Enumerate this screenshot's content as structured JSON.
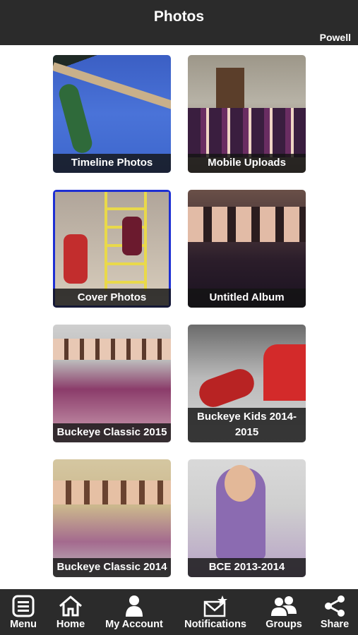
{
  "header": {
    "title": "Photos",
    "subtitle": "Powell"
  },
  "albums": [
    {
      "title": "Timeline Photos"
    },
    {
      "title": "Mobile Uploads"
    },
    {
      "title": "Cover Photos"
    },
    {
      "title": "Untitled Album"
    },
    {
      "title": "Buckeye Classic 2015"
    },
    {
      "title": "Buckeye Kids 2014-2015"
    },
    {
      "title": "Buckeye Classic 2014"
    },
    {
      "title": "BCE 2013-2014"
    }
  ],
  "nav": {
    "items": [
      {
        "label": "Menu",
        "icon": "menu-icon"
      },
      {
        "label": "Home",
        "icon": "home-icon"
      },
      {
        "label": "My Account",
        "icon": "account-icon"
      },
      {
        "label": "Notifications",
        "icon": "notifications-icon"
      },
      {
        "label": "Groups",
        "icon": "groups-icon"
      },
      {
        "label": "Share",
        "icon": "share-icon"
      }
    ]
  },
  "colors": {
    "bar": "#2b2b2b",
    "caption_bg": "#141414",
    "text": "#ffffff"
  }
}
